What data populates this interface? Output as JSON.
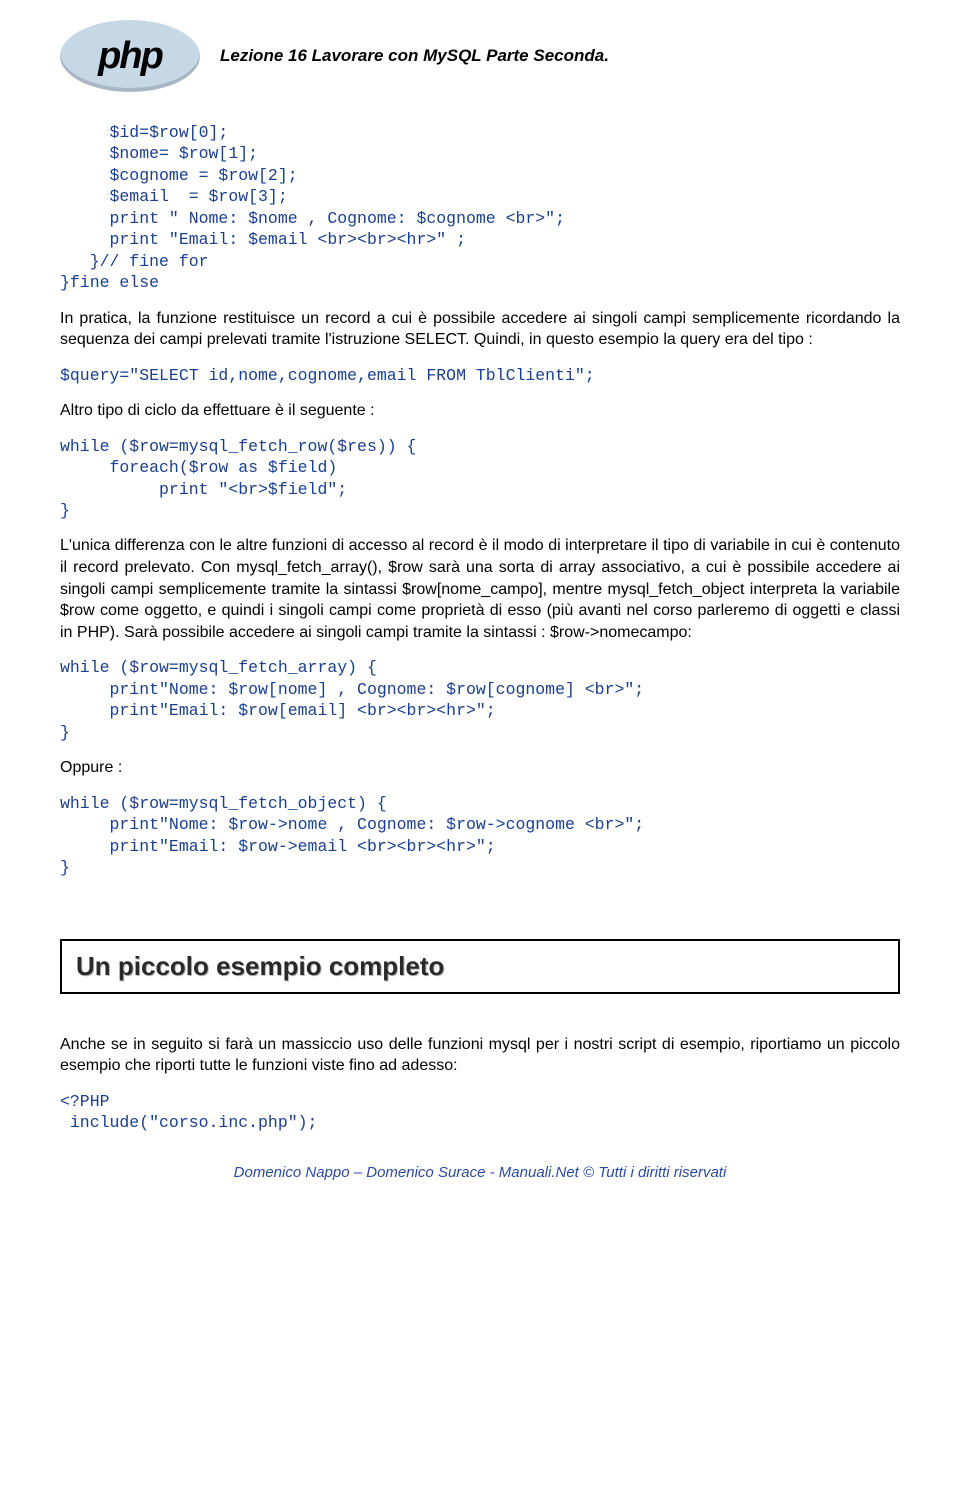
{
  "header": {
    "logo_text": "php",
    "title": "Lezione 16 Lavorare con MySQL Parte Seconda."
  },
  "code1": "     $id=$row[0];\n     $nome= $row[1];\n     $cognome = $row[2];\n     $email  = $row[3];\n     print \" Nome: $nome , Cognome: $cognome <br>\";\n     print \"Email: $email <br><br><hr>\" ;\n   }// fine for\n}fine else",
  "para1": "In pratica, la funzione restituisce un record a cui è possibile accedere ai singoli campi semplicemente ricordando la sequenza dei campi prelevati tramite l'istruzione SELECT. Quindi, in questo esempio la query era del tipo :",
  "code2": "$query=\"SELECT id,nome,cognome,email FROM TblClienti\";",
  "para2": "Altro tipo di ciclo da effettuare è il seguente :",
  "code3": "while ($row=mysql_fetch_row($res)) {\n     foreach($row as $field)\n          print \"<br>$field\";\n}",
  "para3": "L'unica differenza con le altre funzioni di accesso al record è il modo di interpretare il tipo di variabile in cui è contenuto il record prelevato. Con mysql_fetch_array(), $row sarà una sorta di array associativo, a cui è possibile accedere ai singoli campi semplicemente tramite la sintassi $row[nome_campo], mentre mysql_fetch_object interpreta la variabile $row come oggetto, e quindi i singoli campi come proprietà di esso (più avanti nel corso parleremo di oggetti e classi in PHP). Sarà possibile accedere ai singoli campi tramite la sintassi : $row->nomecampo:",
  "code4": "while ($row=mysql_fetch_array) {\n     print\"Nome: $row[nome] , Cognome: $row[cognome] <br>\";\n     print\"Email: $row[email] <br><br><hr>\";\n}",
  "para4": "Oppure :",
  "code5": "while ($row=mysql_fetch_object) {\n     print\"Nome: $row->nome , Cognome: $row->cognome <br>\";\n     print\"Email: $row->email <br><br><hr>\";\n}",
  "section_heading": "Un piccolo esempio completo",
  "para5": "Anche se in seguito si farà un massiccio uso delle funzioni mysql per i nostri script di esempio, riportiamo un piccolo esempio che riporti tutte le funzioni viste fino ad adesso:",
  "code6": "<?PHP\n include(\"corso.inc.php\");",
  "footer": "Domenico Nappo – Domenico Surace - Manuali.Net © Tutti i diritti riservati"
}
